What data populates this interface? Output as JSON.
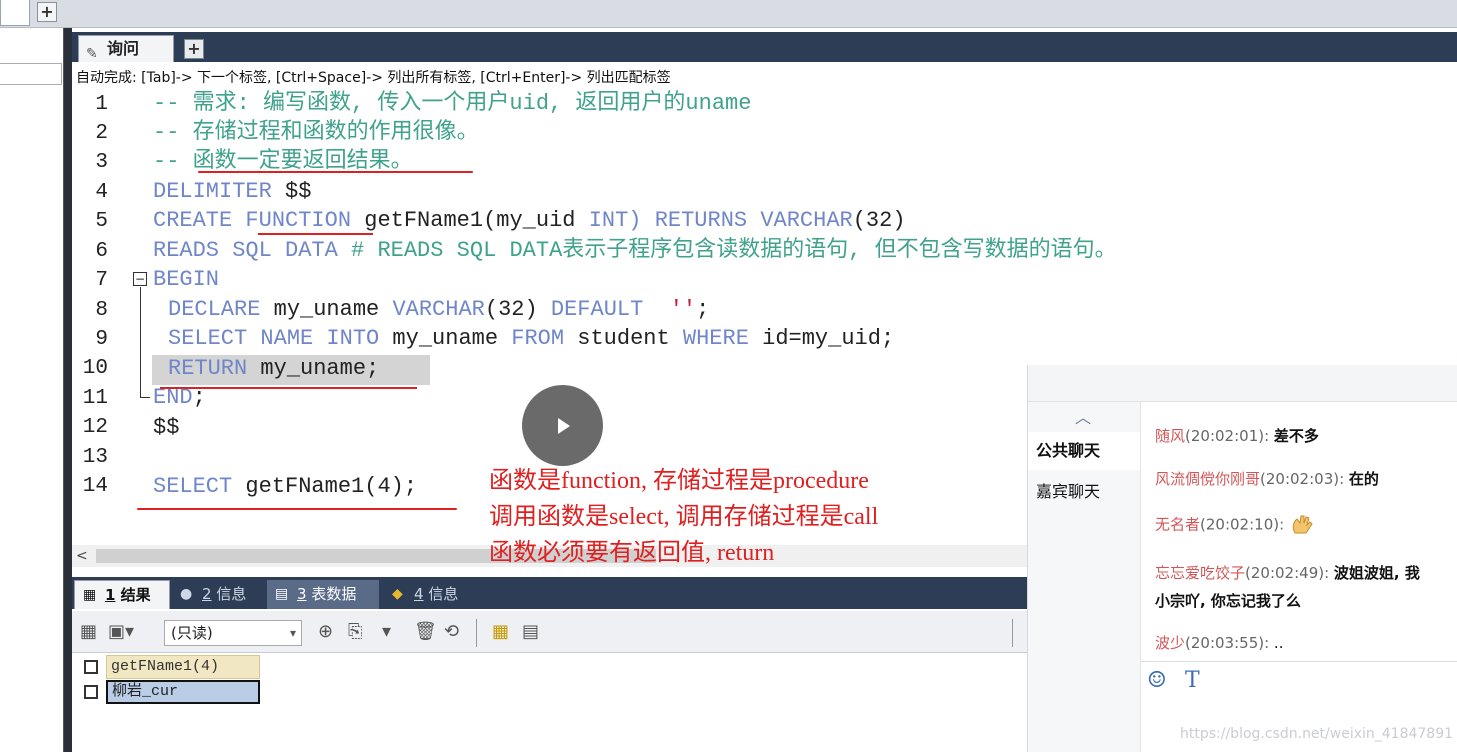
{
  "query_tab": {
    "label": "询问"
  },
  "autocomplete_hint": "自动完成: [Tab]-> 下一个标签, [Ctrl+Space]-> 列出所有标签, [Ctrl+Enter]-> 列出匹配标签",
  "line_numbers": [
    "1",
    "2",
    "3",
    "4",
    "5",
    "6",
    "7",
    "8",
    "9",
    "10",
    "11",
    "12",
    "13",
    "14"
  ],
  "code": {
    "l1": "-- 需求: 编写函数, 传入一个用户uid, 返回用户的uname",
    "l2": "-- 存储过程和函数的作用很像。",
    "l3": "-- 函数一定要返回结果。",
    "l4_kw": "DELIMITER",
    "l4_rest": " $$",
    "l5_kw1": "CREATE FUNCTION",
    "l5_name": " getFName1(my_uid ",
    "l5_kw2": "INT)",
    "l5_kw3": " RETURNS VARCHAR",
    "l5_rest": "(32)",
    "l6_kw": "READS SQL DATA",
    "l6_comment": " # READS SQL DATA表示子程序包含读数据的语句, 但不包含写数据的语句。",
    "l7": "BEGIN",
    "l8_kw1": "DECLARE",
    "l8_var": " my_uname ",
    "l8_kw2": "VARCHAR",
    "l8_num": "(32) ",
    "l8_kw3": "DEFAULT",
    "l8_str": "  ''",
    "l8_end": ";",
    "l9_kw1": "SELECT NAME INTO",
    "l9_var": " my_uname ",
    "l9_kw2": "FROM",
    "l9_tbl": " student ",
    "l9_kw3": "WHERE",
    "l9_rest": " id=my_uid;",
    "l10_kw": "RETURN",
    "l10_rest": " my_uname;",
    "l11_kw": "END",
    "l11_rest": ";",
    "l12": "$$",
    "l14_kw": "SELECT",
    "l14_rest": " getFName1(4);"
  },
  "annotation": {
    "line1": "函数是function, 存储过程是procedure",
    "line2": "调用函数是select, 调用存储过程是call",
    "line3": "函数必须要有返回值, return"
  },
  "result_tabs": [
    {
      "num": "1",
      "label": "结果"
    },
    {
      "num": "2",
      "label": "信息"
    },
    {
      "num": "3",
      "label": "表数据"
    },
    {
      "num": "4",
      "label": "信息"
    }
  ],
  "toolbar": {
    "readonly_label": "(只读)"
  },
  "result_grid": {
    "column": "getFName1(4)",
    "value": "柳岩_cur"
  },
  "chat": {
    "channels": [
      "公共聊天",
      "嘉宾聊天"
    ],
    "messages": [
      {
        "name": "随风",
        "time": "(20:02:01): ",
        "text": "差不多"
      },
      {
        "name": "风流倜傥你刚哥",
        "time": "(20:02:03): ",
        "text": "在的"
      },
      {
        "name": "无名者",
        "time": "(20:02:10): ",
        "text": ""
      },
      {
        "name": "忘忘爱吃饺子",
        "time": "(20:02:49): ",
        "text": "波姐波姐, 我",
        "text2": "小宗吖, 你忘记我了么"
      },
      {
        "name": "波少",
        "time": "(20:03:55): ",
        "text": ".."
      }
    ]
  },
  "watermark": "https://blog.csdn.net/weixin_41847891",
  "colors": {
    "comment": "#3fa28c",
    "keyword": "#6f86c8",
    "annotation": "#e02020",
    "header": "#2d3d55"
  }
}
